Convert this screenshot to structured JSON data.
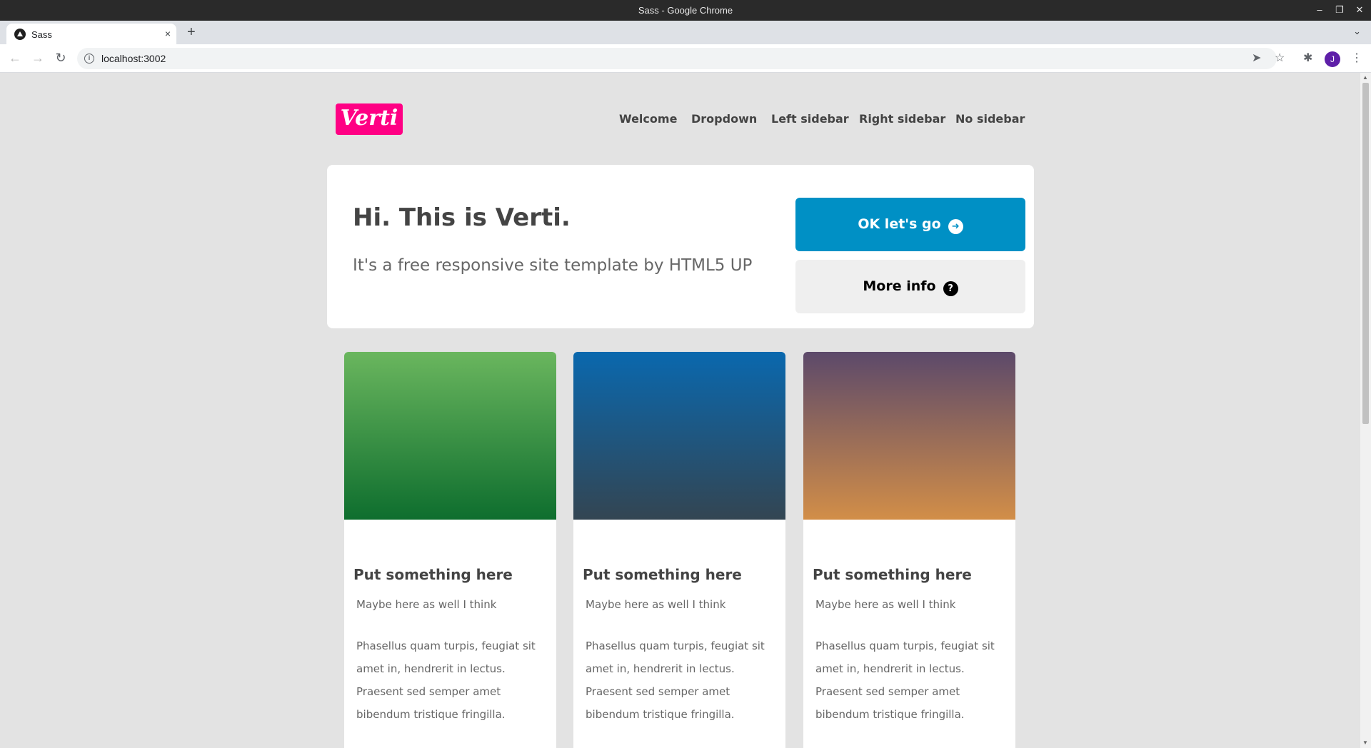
{
  "window": {
    "title": "Sass - Google Chrome"
  },
  "tab": {
    "title": "Sass"
  },
  "address": {
    "url": "localhost:3002"
  },
  "profile": {
    "initial": "J"
  },
  "site": {
    "logo": "Verti",
    "nav": [
      "Welcome",
      "Dropdown",
      "Left sidebar",
      "Right sidebar",
      "No sidebar"
    ]
  },
  "hero": {
    "title": "Hi. This is Verti.",
    "subtitle": "It's a free responsive site template by HTML5 UP",
    "primary_button": "OK let's go",
    "secondary_button": "More info"
  },
  "cards": [
    {
      "title": "Put something here",
      "subtitle": "Maybe here as well I think",
      "body": "Phasellus quam turpis, feugiat sit amet in, hendrerit in lectus. Praesent sed semper amet bibendum tristique fringilla.",
      "gradient": [
        "#6ab65e",
        "#0e6e2e"
      ]
    },
    {
      "title": "Put something here",
      "subtitle": "Maybe here as well I think",
      "body": "Phasellus quam turpis, feugiat sit amet in, hendrerit in lectus. Praesent sed semper amet bibendum tristique fringilla.",
      "gradient": [
        "#0a68ae",
        "#334552"
      ]
    },
    {
      "title": "Put something here",
      "subtitle": "Maybe here as well I think",
      "body": "Phasellus quam turpis, feugiat sit amet in, hendrerit in lectus. Praesent sed semper amet bibendum tristique fringilla.",
      "gradient": [
        "#5c496a",
        "#d28e48"
      ]
    }
  ],
  "colors": {
    "brand": "#ff0084",
    "primary": "#0090c5",
    "background": "#e3e3e3"
  },
  "icons": {
    "tab_close": "×",
    "new_tab": "+",
    "tab_menu": "⌄",
    "back": "←",
    "forward": "→",
    "reload": "↻",
    "info": "i",
    "send": "➤",
    "star": "☆",
    "extensions": "✱",
    "menu": "⋮",
    "minimize": "–",
    "restore": "❐",
    "close": "✕",
    "arrow_circle": "➜",
    "question": "?"
  }
}
